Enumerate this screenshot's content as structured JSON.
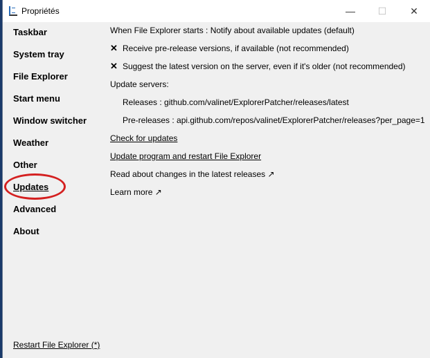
{
  "window": {
    "title": "Propriétés",
    "minimize": "—",
    "maximize": "☐",
    "close": "✕"
  },
  "sidebar": {
    "items": [
      {
        "label": "Taskbar"
      },
      {
        "label": "System tray"
      },
      {
        "label": "File Explorer"
      },
      {
        "label": "Start menu"
      },
      {
        "label": "Window switcher"
      },
      {
        "label": "Weather"
      },
      {
        "label": "Other"
      },
      {
        "label": "Updates",
        "active": true
      },
      {
        "label": "Advanced"
      },
      {
        "label": "About"
      }
    ],
    "restart": "Restart File Explorer (*)"
  },
  "content": {
    "startup": "When File Explorer starts : Notify about available updates (default)",
    "prerelease": {
      "checked": true,
      "mark": "✕",
      "label": "Receive pre-release versions, if available (not recommended)"
    },
    "suggest": {
      "checked": true,
      "mark": "✕",
      "label": "Suggest the latest version on the server, even if it's older (not recommended)"
    },
    "servers_label": "Update servers:",
    "releases": "Releases : github.com/valinet/ExplorerPatcher/releases/latest",
    "prereleases": "Pre-releases : api.github.com/repos/valinet/ExplorerPatcher/releases?per_page=1",
    "check": "Check for updates",
    "update": "Update program and restart File Explorer",
    "read": "Read about changes in the latest releases ↗",
    "learn": "Learn more ↗"
  },
  "colors": {
    "highlight_circle": "#d42020"
  }
}
